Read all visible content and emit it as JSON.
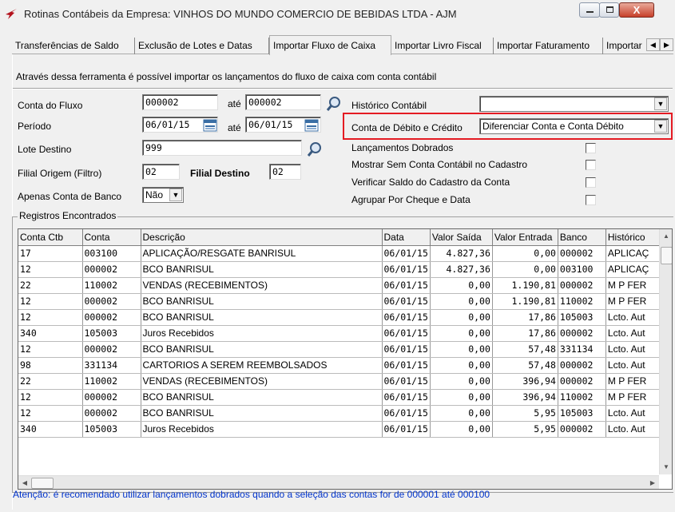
{
  "window": {
    "title": "Rotinas Contábeis da Empresa: VINHOS DO MUNDO COMERCIO DE BEBIDAS LTDA - AJM",
    "close_glyph": "X"
  },
  "tabs": [
    {
      "label": "Transferências de Saldo"
    },
    {
      "label": "Exclusão de Lotes e Datas"
    },
    {
      "label": "Importar Fluxo de Caixa"
    },
    {
      "label": "Importar Livro Fiscal"
    },
    {
      "label": "Importar Faturamento"
    },
    {
      "label": "Importar"
    }
  ],
  "description": "Através dessa ferramenta é possível importar os lançamentos do fluxo de caixa com conta contábil",
  "form": {
    "conta_fluxo_label": "Conta do Fluxo",
    "conta_fluxo_de": "000002",
    "ate_label": "até",
    "conta_fluxo_ate": "000002",
    "periodo_label": "Período",
    "periodo_de": "06/01/15",
    "periodo_ate": "06/01/15",
    "lote_destino_label": "Lote Destino",
    "lote_destino": "999",
    "filial_origem_label": "Filial Origem (Filtro)",
    "filial_origem": "02",
    "filial_destino_label": "Filial Destino",
    "filial_destino": "02",
    "apenas_conta_banco_label": "Apenas Conta de Banco",
    "apenas_conta_banco": "Não",
    "historico_contabil_label": "Histórico Contábil",
    "historico_contabil": "",
    "conta_debito_credito_label": "Conta de Débito e Crédito",
    "conta_debito_credito": "Diferenciar Conta e Conta Débito",
    "lancamentos_dobrados_label": "Lançamentos Dobrados",
    "mostrar_sem_conta_label": "Mostrar Sem Conta Contábil no Cadastro",
    "verificar_saldo_label": "Verificar Saldo do Cadastro da Conta",
    "agrupar_cheque_label": "Agrupar Por Cheque e Data"
  },
  "grid": {
    "group_label": "Registros Encontrados",
    "columns": [
      "Conta Ctb",
      "Conta",
      "Descrição",
      "Data",
      "Valor Saída",
      "Valor Entrada",
      "Banco",
      "Histórico"
    ],
    "rows": [
      [
        "17",
        "003100",
        "APLICAÇÃO/RESGATE BANRISUL",
        "06/01/15",
        "4.827,36",
        "0,00",
        "000002",
        "APLICAÇ"
      ],
      [
        "12",
        "000002",
        "BCO BANRISUL",
        "06/01/15",
        "4.827,36",
        "0,00",
        "003100",
        "APLICAÇ"
      ],
      [
        "22",
        "110002",
        "VENDAS (RECEBIMENTOS)",
        "06/01/15",
        "0,00",
        "1.190,81",
        "000002",
        "M P FER"
      ],
      [
        "12",
        "000002",
        "BCO BANRISUL",
        "06/01/15",
        "0,00",
        "1.190,81",
        "110002",
        "M P FER"
      ],
      [
        "12",
        "000002",
        "BCO BANRISUL",
        "06/01/15",
        "0,00",
        "17,86",
        "105003",
        "Lcto. Aut"
      ],
      [
        "340",
        "105003",
        "Juros Recebidos",
        "06/01/15",
        "0,00",
        "17,86",
        "000002",
        "Lcto. Aut"
      ],
      [
        "12",
        "000002",
        "BCO BANRISUL",
        "06/01/15",
        "0,00",
        "57,48",
        "331134",
        "Lcto. Aut"
      ],
      [
        "98",
        "331134",
        "CARTORIOS A SEREM REEMBOLSADOS",
        "06/01/15",
        "0,00",
        "57,48",
        "000002",
        "Lcto. Aut"
      ],
      [
        "22",
        "110002",
        "VENDAS (RECEBIMENTOS)",
        "06/01/15",
        "0,00",
        "396,94",
        "000002",
        "M P FER"
      ],
      [
        "12",
        "000002",
        "BCO BANRISUL",
        "06/01/15",
        "0,00",
        "396,94",
        "110002",
        "M P FER"
      ],
      [
        "12",
        "000002",
        "BCO BANRISUL",
        "06/01/15",
        "0,00",
        "5,95",
        "105003",
        "Lcto. Aut"
      ],
      [
        "340",
        "105003",
        "Juros Recebidos",
        "06/01/15",
        "0,00",
        "5,95",
        "000002",
        "Lcto. Aut"
      ]
    ]
  },
  "status": "Atenção: é recomendado utilizar lançamentos dobrados quando a seleção das contas for de 000001 até 000100",
  "colors": {
    "highlight": "#e41b23",
    "status_text": "#0033cc"
  }
}
